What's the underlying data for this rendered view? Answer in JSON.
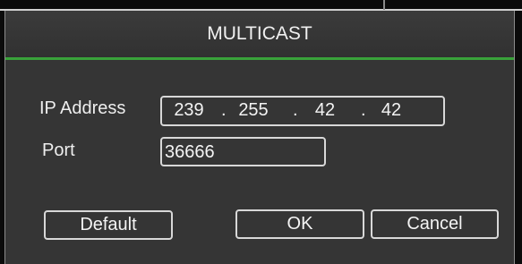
{
  "dialog": {
    "title": "MULTICAST"
  },
  "ip_address": {
    "label": "IP Address",
    "octets": [
      "239",
      "255",
      "42",
      "42"
    ],
    "separator": "."
  },
  "port": {
    "label": "Port",
    "value": "36666"
  },
  "buttons": {
    "default": "Default",
    "ok": "OK",
    "cancel": "Cancel"
  },
  "colors": {
    "accent_line": "#39a23a",
    "panel_bg": "#353535"
  }
}
